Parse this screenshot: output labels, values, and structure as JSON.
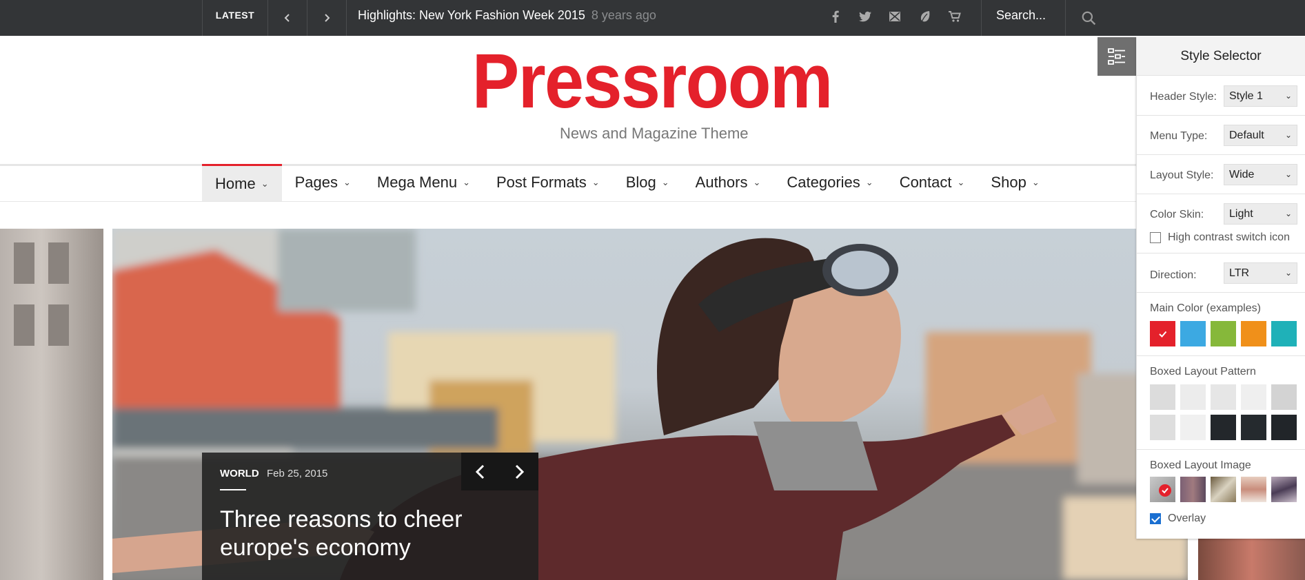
{
  "topbar": {
    "latest_label": "LATEST",
    "headline": "Highlights: New York Fashion Week 2015",
    "headline_ago": "8 years ago",
    "search_placeholder": "Search...",
    "social_icons": [
      "facebook-icon",
      "twitter-icon",
      "envato-icon",
      "leaf-icon",
      "cart-icon"
    ]
  },
  "brand": {
    "logo": "Pressroom",
    "tagline": "News and Magazine Theme",
    "accent_color": "#e4212b"
  },
  "nav": {
    "items": [
      "Home",
      "Pages",
      "Mega Menu",
      "Post Formats",
      "Blog",
      "Authors",
      "Categories",
      "Contact",
      "Shop"
    ],
    "active": "Home"
  },
  "hero": {
    "category": "WORLD",
    "date": "Feb 25, 2015",
    "title": "Three reasons to cheer europe's economy"
  },
  "style_selector": {
    "title": "Style Selector",
    "header_style_label": "Header Style:",
    "header_style_value": "Style 1",
    "menu_type_label": "Menu Type:",
    "menu_type_value": "Default",
    "layout_style_label": "Layout Style:",
    "layout_style_value": "Wide",
    "color_skin_label": "Color Skin:",
    "color_skin_value": "Light",
    "high_contrast_label": "High contrast switch icon",
    "high_contrast_checked": false,
    "direction_label": "Direction:",
    "direction_value": "LTR",
    "main_color_label": "Main Color (examples)",
    "main_colors": [
      "#e4212b",
      "#3ca9e2",
      "#86b83a",
      "#f0901a",
      "#1fb1b8"
    ],
    "main_color_selected": "#e4212b",
    "boxed_pattern_label": "Boxed Layout Pattern",
    "boxed_image_label": "Boxed Layout Image",
    "overlay_label": "Overlay",
    "overlay_checked": true
  }
}
